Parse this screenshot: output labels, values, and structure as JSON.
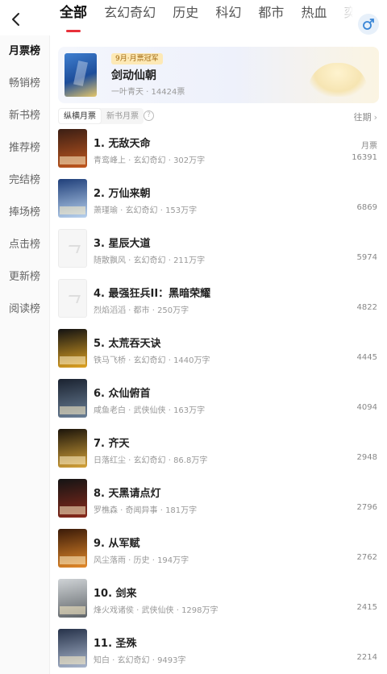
{
  "header": {
    "tabs": [
      "全部",
      "玄幻奇幻",
      "历史",
      "科幻",
      "都市",
      "热血",
      "奕"
    ],
    "active_tab": 0,
    "back_icon": "chevron-left-icon",
    "gender_icon": "gender-icon"
  },
  "sidebar": {
    "items": [
      "月票榜",
      "畅销榜",
      "新书榜",
      "推荐榜",
      "完结榜",
      "捧场榜",
      "点击榜",
      "更新榜",
      "阅读榜"
    ],
    "active": 0
  },
  "banner": {
    "badge": "9月·月票冠军",
    "title": "剑动仙朝",
    "subtitle": "一叶青天 · 14424票",
    "cover_color": "#2d64b8"
  },
  "filter": {
    "chips": [
      "纵横月票",
      "新书月票"
    ],
    "active": 0,
    "help_icon": "?",
    "past_label": "往期"
  },
  "list": {
    "unit_label": "月票",
    "items": [
      {
        "title": "1. 无敌天命",
        "meta": "青鸾峰上 · 玄幻奇幻 · 302万字",
        "votes": "16391",
        "cover": [
          "#3b1e14",
          "#c2581f"
        ]
      },
      {
        "title": "2. 万仙来朝",
        "meta": "萧瑾瑜 · 玄幻奇幻 · 153万字",
        "votes": "6869",
        "cover": [
          "#1f3f7a",
          "#b9d2ee"
        ]
      },
      {
        "title": "3. 星辰大道",
        "meta": "随散飘风 · 玄幻奇幻 · 211万字",
        "votes": "5974",
        "cover": null
      },
      {
        "title": "4. 最强狂兵II：黑暗荣耀",
        "meta": "烈焰滔滔 · 都市 · 250万字",
        "votes": "4822",
        "cover": null
      },
      {
        "title": "5. 太荒吞天诀",
        "meta": "铁马飞桥 · 玄幻奇幻 · 1440万字",
        "votes": "4445",
        "cover": [
          "#121212",
          "#e0a423"
        ]
      },
      {
        "title": "6. 众仙俯首",
        "meta": "咸鱼老白 · 武侠仙侠 · 163万字",
        "votes": "4094",
        "cover": [
          "#1a2230",
          "#6a7f96"
        ]
      },
      {
        "title": "7. 齐天",
        "meta": "日落红尘 · 玄幻奇幻 · 86.8万字",
        "votes": "2948",
        "cover": [
          "#1b140a",
          "#d6a43a"
        ]
      },
      {
        "title": "8. 天黑请点灯",
        "meta": "罗樵森 · 奇闻异事 · 181万字",
        "votes": "2796",
        "cover": [
          "#141414",
          "#8a2a1c"
        ]
      },
      {
        "title": "9. 从军赋",
        "meta": "风尘落雨 · 历史 · 194万字",
        "votes": "2762",
        "cover": [
          "#3a1a08",
          "#e48a2a"
        ]
      },
      {
        "title": "10. 剑来",
        "meta": "烽火戏诸侯 · 武侠仙侠 · 1298万字",
        "votes": "2415",
        "cover": [
          "#cfd3d6",
          "#5f6468"
        ]
      },
      {
        "title": "11. 圣殊",
        "meta": "知白 · 玄幻奇幻 · 9493字",
        "votes": "2214",
        "cover": [
          "#26324a",
          "#a9b6cc"
        ]
      }
    ]
  }
}
